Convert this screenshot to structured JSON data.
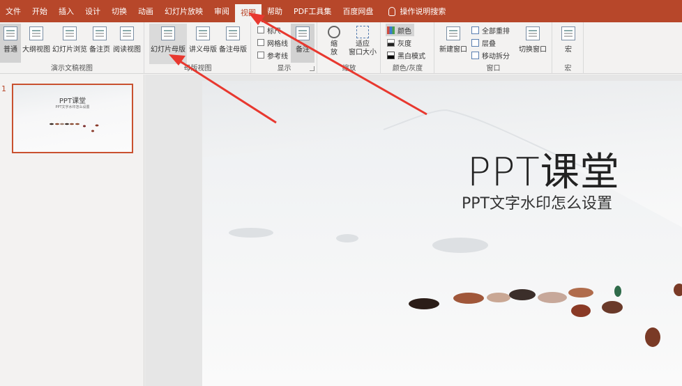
{
  "menu": {
    "tabs": [
      {
        "label": "文件"
      },
      {
        "label": "开始"
      },
      {
        "label": "插入"
      },
      {
        "label": "设计"
      },
      {
        "label": "切换"
      },
      {
        "label": "动画"
      },
      {
        "label": "幻灯片放映"
      },
      {
        "label": "审阅"
      },
      {
        "label": "视图",
        "active": true
      },
      {
        "label": "帮助"
      },
      {
        "label": "PDF工具集"
      },
      {
        "label": "百度网盘"
      }
    ],
    "hint_label": "操作说明搜索",
    "hint_icon": "lightbulb-icon"
  },
  "ribbon": {
    "presentation_views": {
      "label": "演示文稿视图",
      "buttons": [
        "普通",
        "大纲视图",
        "幻灯片浏览",
        "备注页",
        "阅读视图"
      ]
    },
    "master_views": {
      "label": "母版视图",
      "buttons": [
        "幻灯片母版",
        "讲义母版",
        "备注母版"
      ]
    },
    "show": {
      "label": "显示",
      "checkboxes": [
        "标尺",
        "网格线",
        "参考线"
      ],
      "notes_button": "备注"
    },
    "zoom": {
      "label": "缩放",
      "zoom_button": "缩\n放",
      "fit_button": "适应\n窗口大小"
    },
    "color": {
      "label": "颜色/灰度",
      "options": [
        "颜色",
        "灰度",
        "黑白模式"
      ]
    },
    "window": {
      "label": "窗口",
      "new_window": "新建窗口",
      "arrange_all": "全部重排",
      "cascade": "层叠",
      "move_split": "移动拆分",
      "switch_window": "切换窗口"
    },
    "macros": {
      "label": "宏",
      "button": "宏"
    }
  },
  "thumbnails": {
    "number": "1",
    "title": "PPT课堂",
    "subtitle": "PPT文字水印怎么设置"
  },
  "slide": {
    "title": "PPT课堂",
    "subtitle": "PPT文字水印怎么设置"
  },
  "colors": {
    "accent": "#b7472a",
    "ribbon_bg": "#f3f2f1",
    "arrow": "#e8382f"
  }
}
